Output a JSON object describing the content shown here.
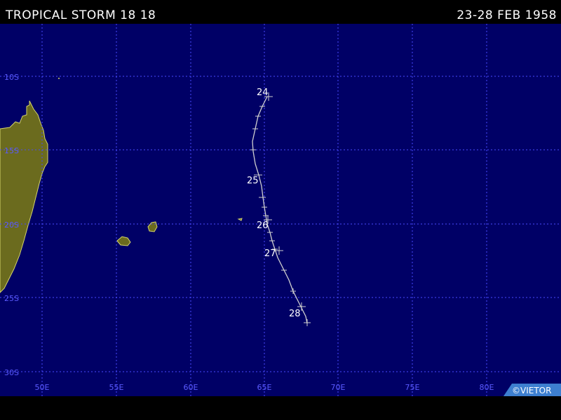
{
  "header": {
    "title": "TROPICAL STORM 18 18",
    "dates": "23-28 FEB 1958"
  },
  "map": {
    "ocean_color": "#000066",
    "land_color": "#6b6b1e",
    "coast_color": "#d4d46a",
    "grid_color": "#4a4aff",
    "track_color": "#cfcfcf",
    "lon_labels": [
      "50E",
      "55E",
      "60E",
      "65E",
      "70E",
      "75E",
      "80E"
    ],
    "lat_labels": [
      "10S",
      "15S",
      "20S",
      "25S",
      "30S"
    ],
    "day_labels": [
      "24",
      "25",
      "26",
      "27",
      "28"
    ],
    "credit": "©VIETOR"
  }
}
